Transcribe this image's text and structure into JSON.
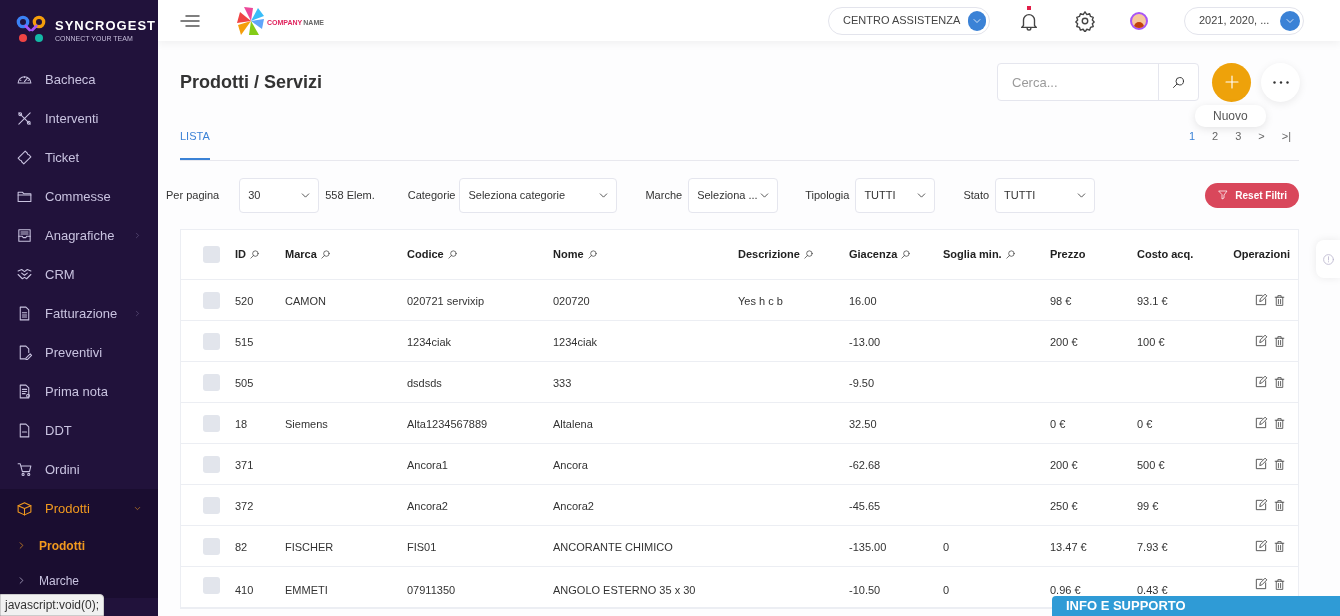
{
  "brand": {
    "name": "SYNCROGEST",
    "tagline": "CONNECT YOUR TEAM"
  },
  "company_logo": {
    "word_1": "COMPANY",
    "word_2": "NAME"
  },
  "header": {
    "help_select": "CENTRO ASSISTENZA",
    "notifications_unread": true,
    "years_select": "2021, 2020, ..."
  },
  "sidebar": {
    "items": [
      {
        "label": "Bacheca",
        "selected": false,
        "has_submenu": false
      },
      {
        "label": "Interventi",
        "selected": false,
        "has_submenu": false
      },
      {
        "label": "Ticket",
        "selected": false,
        "has_submenu": false
      },
      {
        "label": "Commesse",
        "selected": false,
        "has_submenu": false
      },
      {
        "label": "Anagrafiche",
        "selected": false,
        "has_submenu": true,
        "expanded": false
      },
      {
        "label": "CRM",
        "selected": false,
        "has_submenu": false
      },
      {
        "label": "Fatturazione",
        "selected": false,
        "has_submenu": true,
        "expanded": false
      },
      {
        "label": "Preventivi",
        "selected": false,
        "has_submenu": false
      },
      {
        "label": "Prima nota",
        "selected": false,
        "has_submenu": false
      },
      {
        "label": "DDT",
        "selected": false,
        "has_submenu": false
      },
      {
        "label": "Ordini",
        "selected": false,
        "has_submenu": false
      },
      {
        "label": "Prodotti",
        "selected": true,
        "has_submenu": true,
        "expanded": true,
        "children": [
          {
            "label": "Prodotti",
            "selected": true
          },
          {
            "label": "Marche",
            "selected": false
          }
        ]
      }
    ]
  },
  "page": {
    "title": "Prodotti / Servizi",
    "search_placeholder": "Cerca...",
    "tooltip": "Nuovo"
  },
  "tabs": [
    {
      "label": "LISTA",
      "selected": true
    }
  ],
  "pagination": [
    {
      "label": "1",
      "selected": true
    },
    {
      "label": "2",
      "selected": false
    },
    {
      "label": "3",
      "selected": false
    },
    {
      "label": ">",
      "selected": false
    },
    {
      "label": ">|",
      "selected": false
    }
  ],
  "filters": {
    "per_page_label": "Per pagina",
    "per_page": "30",
    "count": "558 Elem.",
    "categories_label": "Categorie",
    "categories": "Seleziona categorie",
    "brands_label": "Marche",
    "brands": "Seleziona ...",
    "type_label": "Tipologia",
    "type": "TUTTI",
    "state_label": "Stato",
    "state": "TUTTI",
    "reset": "Reset Filtri"
  },
  "table": {
    "select_all_checked": false,
    "columns": [
      {
        "label": "ID",
        "searchable": true
      },
      {
        "label": "Marca",
        "searchable": true
      },
      {
        "label": "Codice",
        "searchable": true
      },
      {
        "label": "Nome",
        "searchable": true
      },
      {
        "label": "Descrizione",
        "searchable": true
      },
      {
        "label": "Giacenza",
        "searchable": true
      },
      {
        "label": "Soglia min.",
        "searchable": true
      },
      {
        "label": "Prezzo",
        "searchable": false
      },
      {
        "label": "Costo acq.",
        "searchable": false
      },
      {
        "label": "Operazioni",
        "searchable": false
      }
    ],
    "rows": [
      {
        "checked": false,
        "cells": [
          "520",
          "CAMON",
          "020721 servixip",
          "020720",
          "Yes h c b",
          "16.00",
          "",
          "98 €",
          "93.1 €"
        ]
      },
      {
        "checked": false,
        "cells": [
          "515",
          "",
          "1234ciak",
          "1234ciak",
          "",
          "-13.00",
          "",
          "200 €",
          "100 €"
        ]
      },
      {
        "checked": false,
        "cells": [
          "505",
          "",
          "dsdsds",
          "333",
          "",
          "-9.50",
          "",
          "",
          ""
        ]
      },
      {
        "checked": false,
        "cells": [
          "18",
          "Siemens",
          "Alta1234567889",
          "Altalena",
          "",
          "32.50",
          "",
          "0 €",
          "0 €"
        ]
      },
      {
        "checked": false,
        "cells": [
          "371",
          "",
          "Ancora1",
          "Ancora",
          "",
          "-62.68",
          "",
          "200 €",
          "500 €"
        ]
      },
      {
        "checked": false,
        "cells": [
          "372",
          "",
          "Ancora2",
          "Ancora2",
          "",
          "-45.65",
          "",
          "250 €",
          "99 €"
        ]
      },
      {
        "checked": false,
        "cells": [
          "82",
          "FISCHER",
          "FIS01",
          "ANCORANTE CHIMICO",
          "",
          "-135.00",
          "0",
          "13.47 €",
          "7.93 €"
        ]
      },
      {
        "checked": false,
        "cells": [
          "410",
          "EMMETI",
          "07911350",
          "ANGOLO ESTERNO 35 x 30",
          "",
          "-10.50",
          "0",
          "0.96 €",
          "0.43 €"
        ]
      }
    ]
  },
  "support_bar": "INFO E SUPPORTO",
  "status_url": "javascript:void(0);"
}
